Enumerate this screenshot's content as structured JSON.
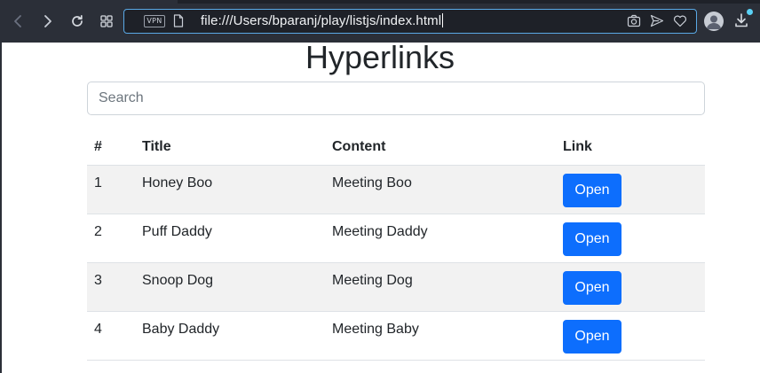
{
  "browser": {
    "vpn_label": "VPN",
    "url": "file:///Users/bparanj/play/listjs/index.html",
    "icons": [
      "back-icon",
      "forward-icon",
      "reload-icon",
      "tabs-grid-icon",
      "file-icon",
      "camera-icon",
      "send-icon",
      "heart-icon",
      "profile-icon",
      "download-icon"
    ]
  },
  "page": {
    "title": "Hyperlinks",
    "search": {
      "placeholder": "Search",
      "value": ""
    }
  },
  "table": {
    "columns": [
      "#",
      "Title",
      "Content",
      "Link"
    ],
    "rows": [
      {
        "num": "1",
        "title": "Honey Boo",
        "content": "Meeting Boo",
        "link_label": "Open"
      },
      {
        "num": "2",
        "title": "Puff Daddy",
        "content": "Meeting Daddy",
        "link_label": "Open"
      },
      {
        "num": "3",
        "title": "Snoop Dog",
        "content": "Meeting Dog",
        "link_label": "Open"
      },
      {
        "num": "4",
        "title": "Baby Daddy",
        "content": "Meeting Baby",
        "link_label": "Open"
      }
    ]
  },
  "colors": {
    "primary": "#0d6efd",
    "stripe": "#f2f2f2",
    "chrome": "#2b2f38",
    "url_focus": "#5aa9e6"
  }
}
